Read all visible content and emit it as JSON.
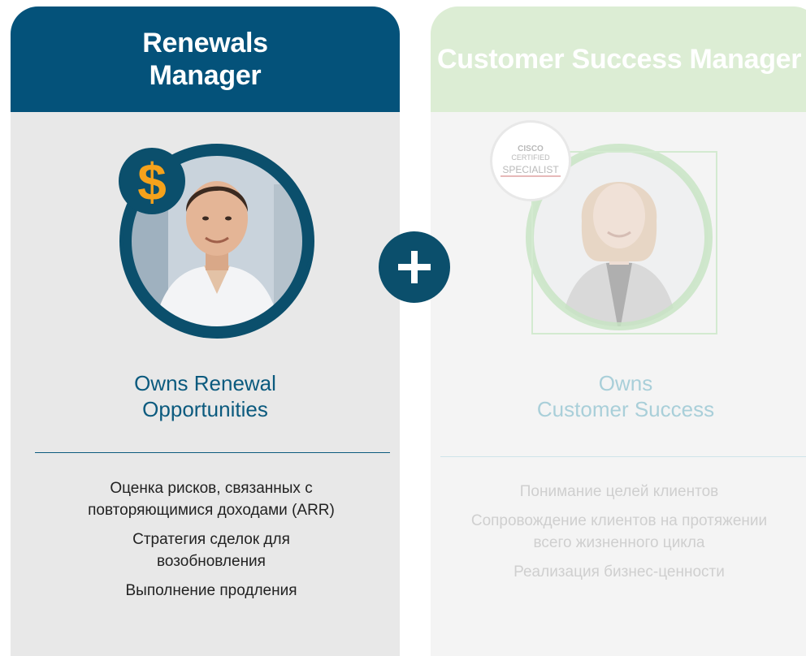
{
  "left_card": {
    "title": "Renewals Manager",
    "caption_line1": "Owns Renewal",
    "caption_line2": "Opportunities",
    "duties": [
      "Оценка рисков, связанных с повторяющимися доходами (ARR)",
      "Стратегия сделок для возобновления",
      "Выполнение продления"
    ],
    "badge_symbol": "$"
  },
  "right_card": {
    "title": "Customer Success Manager",
    "caption_line1": "Owns",
    "caption_line2": "Customer Success",
    "duties": [
      "Понимание целей клиентов",
      "Сопровождение клиентов на протяжении всего жизненного цикла",
      "Реализация бизнес-ценности"
    ],
    "badge_line1": "CISCO",
    "badge_line2": "CERTIFIED",
    "badge_line3": "SPECIALIST"
  },
  "colors": {
    "navy": "#04527a",
    "left_text": "#0b5a7e",
    "pale_green": "#dcedd4",
    "faded_text": "#a9cfd9",
    "faded_duties": "#cfcfcf",
    "orange": "#f5a21b"
  },
  "icons": {
    "plus": "plus-icon",
    "dollar": "dollar-icon"
  }
}
